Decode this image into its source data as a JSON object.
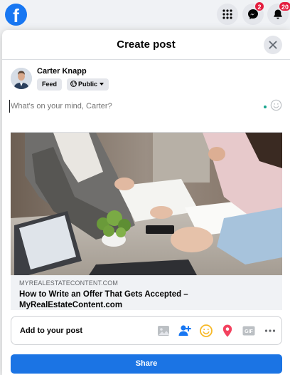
{
  "topbar": {
    "logo_letter": "f",
    "messenger_badge": "2",
    "notifications_badge": "20"
  },
  "modal": {
    "title": "Create post"
  },
  "user": {
    "name": "Carter Knapp",
    "audience_feed": "Feed",
    "audience_privacy": "Public"
  },
  "composer": {
    "placeholder": "What's on your mind, Carter?"
  },
  "link_preview": {
    "domain": "MYREALESTATECONTENT.COM",
    "title": "How to Write an Offer That Gets Accepted – MyRealEstateContent.com"
  },
  "add_to_post": {
    "label": "Add to your post",
    "icons": [
      "photo-icon",
      "tag-people-icon",
      "feeling-icon",
      "location-icon",
      "gif-icon",
      "more-icon"
    ]
  },
  "actions": {
    "share_label": "Share"
  },
  "colors": {
    "brand_blue": "#1877f2",
    "share_blue": "#1b74e4",
    "badge_red": "#e41e3f",
    "feeling_yellow": "#f7b928",
    "location_red": "#f3425f",
    "tag_blue": "#1877f2",
    "photo_gray": "#bcc0c4",
    "status_green": "#18a58e"
  }
}
